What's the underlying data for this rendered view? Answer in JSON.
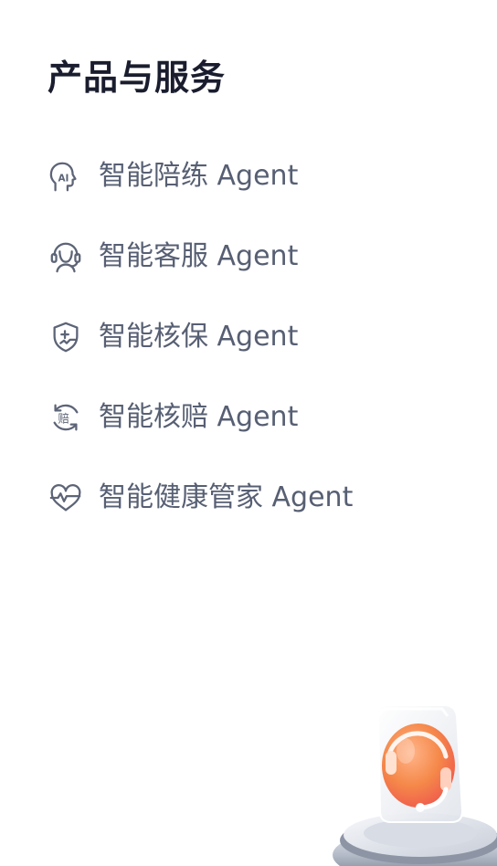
{
  "section": {
    "title": "产品与服务"
  },
  "menu": {
    "items": [
      {
        "label": "智能陪练 Agent",
        "icon": "ai-head-icon"
      },
      {
        "label": "智能客服 Agent",
        "icon": "headset-agent-icon"
      },
      {
        "label": "智能核保 Agent",
        "icon": "shield-plus-icon"
      },
      {
        "label": "智能核赔 Agent",
        "icon": "claim-cycle-icon"
      },
      {
        "label": "智能健康管家 Agent",
        "icon": "heart-pulse-icon"
      }
    ]
  },
  "colors": {
    "title": "#1a1d2e",
    "label": "#575f73",
    "icon_stroke": "#5d6477",
    "hero_orange": "#f5894a",
    "hero_red": "#ef5a4c"
  }
}
